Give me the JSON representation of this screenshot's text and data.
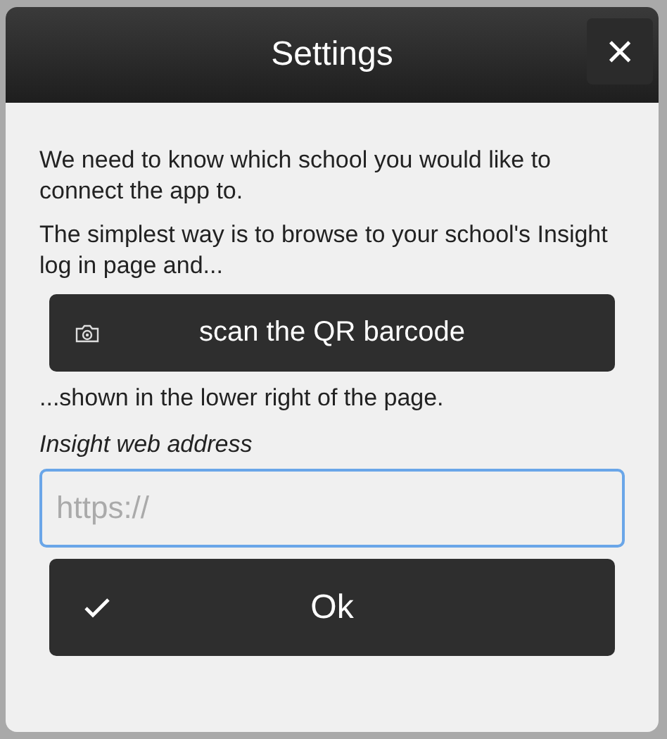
{
  "window": {
    "title": "Settings",
    "close": "×"
  },
  "paragraphs": [
    "We need to know which school you would like to connect the app to.",
    "The simplest way is to browse to your school's Insight log in page and..."
  ],
  "scan_button": {
    "label": "scan the QR barcode"
  },
  "after_text": "...shown in the lower right of the page.",
  "address_field": {
    "label": "Insight web address",
    "placeholder": "https://",
    "focused": true
  },
  "ok_button": {
    "label": "Ok"
  }
}
